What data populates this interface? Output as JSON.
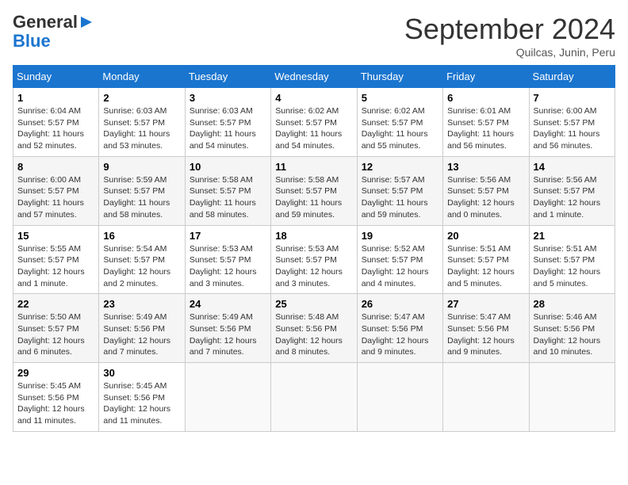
{
  "logo": {
    "line1": "General",
    "line2": "Blue"
  },
  "header": {
    "month": "September 2024",
    "location": "Quilcas, Junin, Peru"
  },
  "weekdays": [
    "Sunday",
    "Monday",
    "Tuesday",
    "Wednesday",
    "Thursday",
    "Friday",
    "Saturday"
  ],
  "weeks": [
    [
      {
        "day": "1",
        "info": "Sunrise: 6:04 AM\nSunset: 5:57 PM\nDaylight: 11 hours\nand 52 minutes."
      },
      {
        "day": "2",
        "info": "Sunrise: 6:03 AM\nSunset: 5:57 PM\nDaylight: 11 hours\nand 53 minutes."
      },
      {
        "day": "3",
        "info": "Sunrise: 6:03 AM\nSunset: 5:57 PM\nDaylight: 11 hours\nand 54 minutes."
      },
      {
        "day": "4",
        "info": "Sunrise: 6:02 AM\nSunset: 5:57 PM\nDaylight: 11 hours\nand 54 minutes."
      },
      {
        "day": "5",
        "info": "Sunrise: 6:02 AM\nSunset: 5:57 PM\nDaylight: 11 hours\nand 55 minutes."
      },
      {
        "day": "6",
        "info": "Sunrise: 6:01 AM\nSunset: 5:57 PM\nDaylight: 11 hours\nand 56 minutes."
      },
      {
        "day": "7",
        "info": "Sunrise: 6:00 AM\nSunset: 5:57 PM\nDaylight: 11 hours\nand 56 minutes."
      }
    ],
    [
      {
        "day": "8",
        "info": "Sunrise: 6:00 AM\nSunset: 5:57 PM\nDaylight: 11 hours\nand 57 minutes."
      },
      {
        "day": "9",
        "info": "Sunrise: 5:59 AM\nSunset: 5:57 PM\nDaylight: 11 hours\nand 58 minutes."
      },
      {
        "day": "10",
        "info": "Sunrise: 5:58 AM\nSunset: 5:57 PM\nDaylight: 11 hours\nand 58 minutes."
      },
      {
        "day": "11",
        "info": "Sunrise: 5:58 AM\nSunset: 5:57 PM\nDaylight: 11 hours\nand 59 minutes."
      },
      {
        "day": "12",
        "info": "Sunrise: 5:57 AM\nSunset: 5:57 PM\nDaylight: 11 hours\nand 59 minutes."
      },
      {
        "day": "13",
        "info": "Sunrise: 5:56 AM\nSunset: 5:57 PM\nDaylight: 12 hours\nand 0 minutes."
      },
      {
        "day": "14",
        "info": "Sunrise: 5:56 AM\nSunset: 5:57 PM\nDaylight: 12 hours\nand 1 minute."
      }
    ],
    [
      {
        "day": "15",
        "info": "Sunrise: 5:55 AM\nSunset: 5:57 PM\nDaylight: 12 hours\nand 1 minute."
      },
      {
        "day": "16",
        "info": "Sunrise: 5:54 AM\nSunset: 5:57 PM\nDaylight: 12 hours\nand 2 minutes."
      },
      {
        "day": "17",
        "info": "Sunrise: 5:53 AM\nSunset: 5:57 PM\nDaylight: 12 hours\nand 3 minutes."
      },
      {
        "day": "18",
        "info": "Sunrise: 5:53 AM\nSunset: 5:57 PM\nDaylight: 12 hours\nand 3 minutes."
      },
      {
        "day": "19",
        "info": "Sunrise: 5:52 AM\nSunset: 5:57 PM\nDaylight: 12 hours\nand 4 minutes."
      },
      {
        "day": "20",
        "info": "Sunrise: 5:51 AM\nSunset: 5:57 PM\nDaylight: 12 hours\nand 5 minutes."
      },
      {
        "day": "21",
        "info": "Sunrise: 5:51 AM\nSunset: 5:57 PM\nDaylight: 12 hours\nand 5 minutes."
      }
    ],
    [
      {
        "day": "22",
        "info": "Sunrise: 5:50 AM\nSunset: 5:57 PM\nDaylight: 12 hours\nand 6 minutes."
      },
      {
        "day": "23",
        "info": "Sunrise: 5:49 AM\nSunset: 5:56 PM\nDaylight: 12 hours\nand 7 minutes."
      },
      {
        "day": "24",
        "info": "Sunrise: 5:49 AM\nSunset: 5:56 PM\nDaylight: 12 hours\nand 7 minutes."
      },
      {
        "day": "25",
        "info": "Sunrise: 5:48 AM\nSunset: 5:56 PM\nDaylight: 12 hours\nand 8 minutes."
      },
      {
        "day": "26",
        "info": "Sunrise: 5:47 AM\nSunset: 5:56 PM\nDaylight: 12 hours\nand 9 minutes."
      },
      {
        "day": "27",
        "info": "Sunrise: 5:47 AM\nSunset: 5:56 PM\nDaylight: 12 hours\nand 9 minutes."
      },
      {
        "day": "28",
        "info": "Sunrise: 5:46 AM\nSunset: 5:56 PM\nDaylight: 12 hours\nand 10 minutes."
      }
    ],
    [
      {
        "day": "29",
        "info": "Sunrise: 5:45 AM\nSunset: 5:56 PM\nDaylight: 12 hours\nand 11 minutes."
      },
      {
        "day": "30",
        "info": "Sunrise: 5:45 AM\nSunset: 5:56 PM\nDaylight: 12 hours\nand 11 minutes."
      },
      {
        "day": "",
        "info": ""
      },
      {
        "day": "",
        "info": ""
      },
      {
        "day": "",
        "info": ""
      },
      {
        "day": "",
        "info": ""
      },
      {
        "day": "",
        "info": ""
      }
    ]
  ]
}
